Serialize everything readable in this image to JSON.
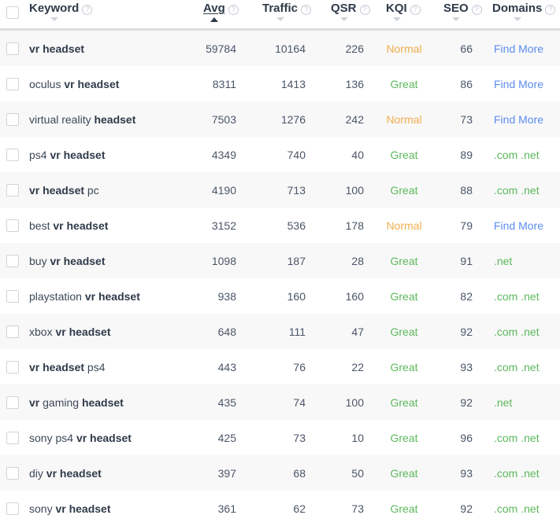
{
  "table": {
    "columns": [
      {
        "key": "select",
        "label": "",
        "has_help": false,
        "sort": "none",
        "align": "left"
      },
      {
        "key": "keyword",
        "label": "Keyword",
        "has_help": true,
        "sort": "desc",
        "align": "left"
      },
      {
        "key": "avg",
        "label": "Avg",
        "has_help": true,
        "sort": "asc-active",
        "align": "right"
      },
      {
        "key": "traffic",
        "label": "Traffic",
        "has_help": true,
        "sort": "desc",
        "align": "right"
      },
      {
        "key": "qsr",
        "label": "QSR",
        "has_help": true,
        "sort": "desc",
        "align": "right"
      },
      {
        "key": "kqi",
        "label": "KQI",
        "has_help": true,
        "sort": "desc",
        "align": "center"
      },
      {
        "key": "seo",
        "label": "SEO",
        "has_help": true,
        "sort": "desc",
        "align": "right"
      },
      {
        "key": "domains",
        "label": "Domains",
        "has_help": true,
        "sort": "desc",
        "align": "left"
      }
    ],
    "header_checkbox_checked": false,
    "icons": {
      "help": "help-circle-icon",
      "sort_asc": "sort-ascending-caret-icon",
      "sort_desc": "sort-descending-caret-icon",
      "checkbox": "checkbox-icon"
    },
    "colors": {
      "kqi_normal": "#f0ad4e",
      "kqi_great": "#5cb85c",
      "domain_link": "#5b8def",
      "domain_available": "#5cb85c",
      "row_alt_bg": "#f8f8f8",
      "row_bg": "#ffffff",
      "divider": "#dddddd"
    },
    "rows": [
      {
        "checked": false,
        "keyword_parts": [
          {
            "t": "vr headset",
            "b": true
          }
        ],
        "keyword_plain": "vr headset",
        "avg": "59784",
        "traffic": "10164",
        "qsr": "226",
        "kqi": "Normal",
        "kqi_kind": "normal",
        "seo": "66",
        "domains": "Find More",
        "domains_kind": "link"
      },
      {
        "checked": false,
        "keyword_parts": [
          {
            "t": "oculus ",
            "b": false
          },
          {
            "t": "vr headset",
            "b": true
          }
        ],
        "keyword_plain": "oculus vr headset",
        "avg": "8311",
        "traffic": "1413",
        "qsr": "136",
        "kqi": "Great",
        "kqi_kind": "great",
        "seo": "86",
        "domains": "Find More",
        "domains_kind": "link"
      },
      {
        "checked": false,
        "keyword_parts": [
          {
            "t": "virtual reality ",
            "b": false
          },
          {
            "t": "headset",
            "b": true
          }
        ],
        "keyword_plain": "virtual reality headset",
        "avg": "7503",
        "traffic": "1276",
        "qsr": "242",
        "kqi": "Normal",
        "kqi_kind": "normal",
        "seo": "73",
        "domains": "Find More",
        "domains_kind": "link"
      },
      {
        "checked": false,
        "keyword_parts": [
          {
            "t": "ps4 ",
            "b": false
          },
          {
            "t": "vr headset",
            "b": true
          }
        ],
        "keyword_plain": "ps4 vr headset",
        "avg": "4349",
        "traffic": "740",
        "qsr": "40",
        "kqi": "Great",
        "kqi_kind": "great",
        "seo": "89",
        "domains": ".com .net",
        "domains_kind": "available"
      },
      {
        "checked": false,
        "keyword_parts": [
          {
            "t": "vr headset",
            "b": true
          },
          {
            "t": " pc",
            "b": false
          }
        ],
        "keyword_plain": "vr headset pc",
        "avg": "4190",
        "traffic": "713",
        "qsr": "100",
        "kqi": "Great",
        "kqi_kind": "great",
        "seo": "88",
        "domains": ".com .net",
        "domains_kind": "available"
      },
      {
        "checked": false,
        "keyword_parts": [
          {
            "t": "best ",
            "b": false
          },
          {
            "t": "vr headset",
            "b": true
          }
        ],
        "keyword_plain": "best vr headset",
        "avg": "3152",
        "traffic": "536",
        "qsr": "178",
        "kqi": "Normal",
        "kqi_kind": "normal",
        "seo": "79",
        "domains": "Find More",
        "domains_kind": "link"
      },
      {
        "checked": false,
        "keyword_parts": [
          {
            "t": "buy ",
            "b": false
          },
          {
            "t": "vr headset",
            "b": true
          }
        ],
        "keyword_plain": "buy vr headset",
        "avg": "1098",
        "traffic": "187",
        "qsr": "28",
        "kqi": "Great",
        "kqi_kind": "great",
        "seo": "91",
        "domains": ".net",
        "domains_kind": "available"
      },
      {
        "checked": false,
        "keyword_parts": [
          {
            "t": "playstation ",
            "b": false
          },
          {
            "t": "vr headset",
            "b": true
          }
        ],
        "keyword_plain": "playstation vr headset",
        "avg": "938",
        "traffic": "160",
        "qsr": "160",
        "kqi": "Great",
        "kqi_kind": "great",
        "seo": "82",
        "domains": ".com .net",
        "domains_kind": "available"
      },
      {
        "checked": false,
        "keyword_parts": [
          {
            "t": "xbox ",
            "b": false
          },
          {
            "t": "vr headset",
            "b": true
          }
        ],
        "keyword_plain": "xbox vr headset",
        "avg": "648",
        "traffic": "111",
        "qsr": "47",
        "kqi": "Great",
        "kqi_kind": "great",
        "seo": "92",
        "domains": ".com .net",
        "domains_kind": "available"
      },
      {
        "checked": false,
        "keyword_parts": [
          {
            "t": "vr headset",
            "b": true
          },
          {
            "t": " ps4",
            "b": false
          }
        ],
        "keyword_plain": "vr headset ps4",
        "avg": "443",
        "traffic": "76",
        "qsr": "22",
        "kqi": "Great",
        "kqi_kind": "great",
        "seo": "93",
        "domains": ".com .net",
        "domains_kind": "available"
      },
      {
        "checked": false,
        "keyword_parts": [
          {
            "t": "vr",
            "b": true
          },
          {
            "t": " gaming ",
            "b": false
          },
          {
            "t": "headset",
            "b": true
          }
        ],
        "keyword_plain": "vr gaming headset",
        "avg": "435",
        "traffic": "74",
        "qsr": "100",
        "kqi": "Great",
        "kqi_kind": "great",
        "seo": "92",
        "domains": ".net",
        "domains_kind": "available"
      },
      {
        "checked": false,
        "keyword_parts": [
          {
            "t": "sony ps4 ",
            "b": false
          },
          {
            "t": "vr headset",
            "b": true
          }
        ],
        "keyword_plain": "sony ps4 vr headset",
        "avg": "425",
        "traffic": "73",
        "qsr": "10",
        "kqi": "Great",
        "kqi_kind": "great",
        "seo": "96",
        "domains": ".com .net",
        "domains_kind": "available"
      },
      {
        "checked": false,
        "keyword_parts": [
          {
            "t": "diy ",
            "b": false
          },
          {
            "t": "vr headset",
            "b": true
          }
        ],
        "keyword_plain": "diy vr headset",
        "avg": "397",
        "traffic": "68",
        "qsr": "50",
        "kqi": "Great",
        "kqi_kind": "great",
        "seo": "93",
        "domains": ".com .net",
        "domains_kind": "available"
      },
      {
        "checked": false,
        "keyword_parts": [
          {
            "t": "sony ",
            "b": false
          },
          {
            "t": "vr headset",
            "b": true
          }
        ],
        "keyword_plain": "sony vr headset",
        "avg": "361",
        "traffic": "62",
        "qsr": "73",
        "kqi": "Great",
        "kqi_kind": "great",
        "seo": "92",
        "domains": ".com .net",
        "domains_kind": "available"
      }
    ]
  }
}
